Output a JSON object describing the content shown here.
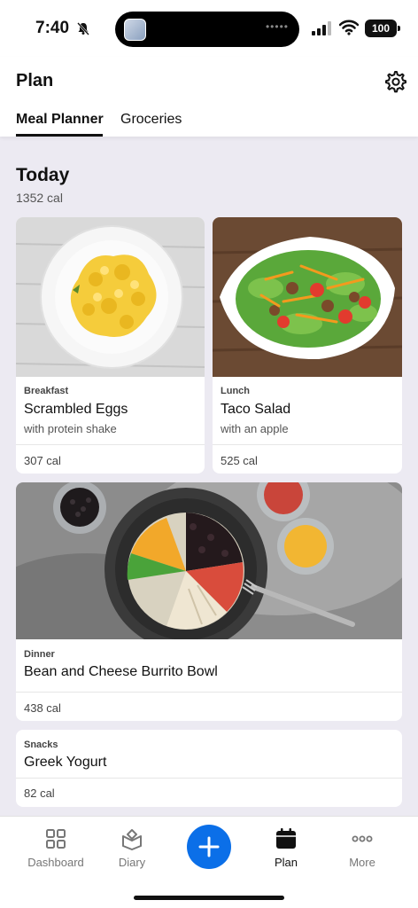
{
  "status": {
    "time": "7:40",
    "battery": "100",
    "icons": [
      "bell-muted-icon",
      "cellular-signal-icon",
      "wifi-icon",
      "battery-icon"
    ]
  },
  "header": {
    "title": "Plan",
    "settings_icon": "gear-icon",
    "tabs": [
      {
        "label": "Meal Planner",
        "active": true
      },
      {
        "label": "Groceries",
        "active": false
      }
    ]
  },
  "day": {
    "title": "Today",
    "calories": "1352 cal"
  },
  "meals": [
    {
      "type": "Breakfast",
      "name": "Scrambled Eggs",
      "sub": "with protein shake",
      "calories": "307 cal"
    },
    {
      "type": "Lunch",
      "name": "Taco Salad",
      "sub": "with an apple",
      "calories": "525 cal"
    },
    {
      "type": "Dinner",
      "name": "Bean and Cheese Burrito Bowl",
      "calories": "438 cal"
    },
    {
      "type": "Snacks",
      "name": "Greek Yogurt",
      "calories": "82 cal"
    }
  ],
  "tabbar": {
    "items": [
      {
        "label": "Dashboard",
        "icon": "dashboard-grid-icon"
      },
      {
        "label": "Diary",
        "icon": "diary-book-icon"
      },
      {
        "label": "",
        "icon": "plus-icon"
      },
      {
        "label": "Plan",
        "icon": "calendar-icon",
        "active": true
      },
      {
        "label": "More",
        "icon": "more-dots-icon"
      }
    ]
  },
  "colors": {
    "accent": "#0b6fe8",
    "background": "#eceaf2",
    "card": "#ffffff"
  }
}
